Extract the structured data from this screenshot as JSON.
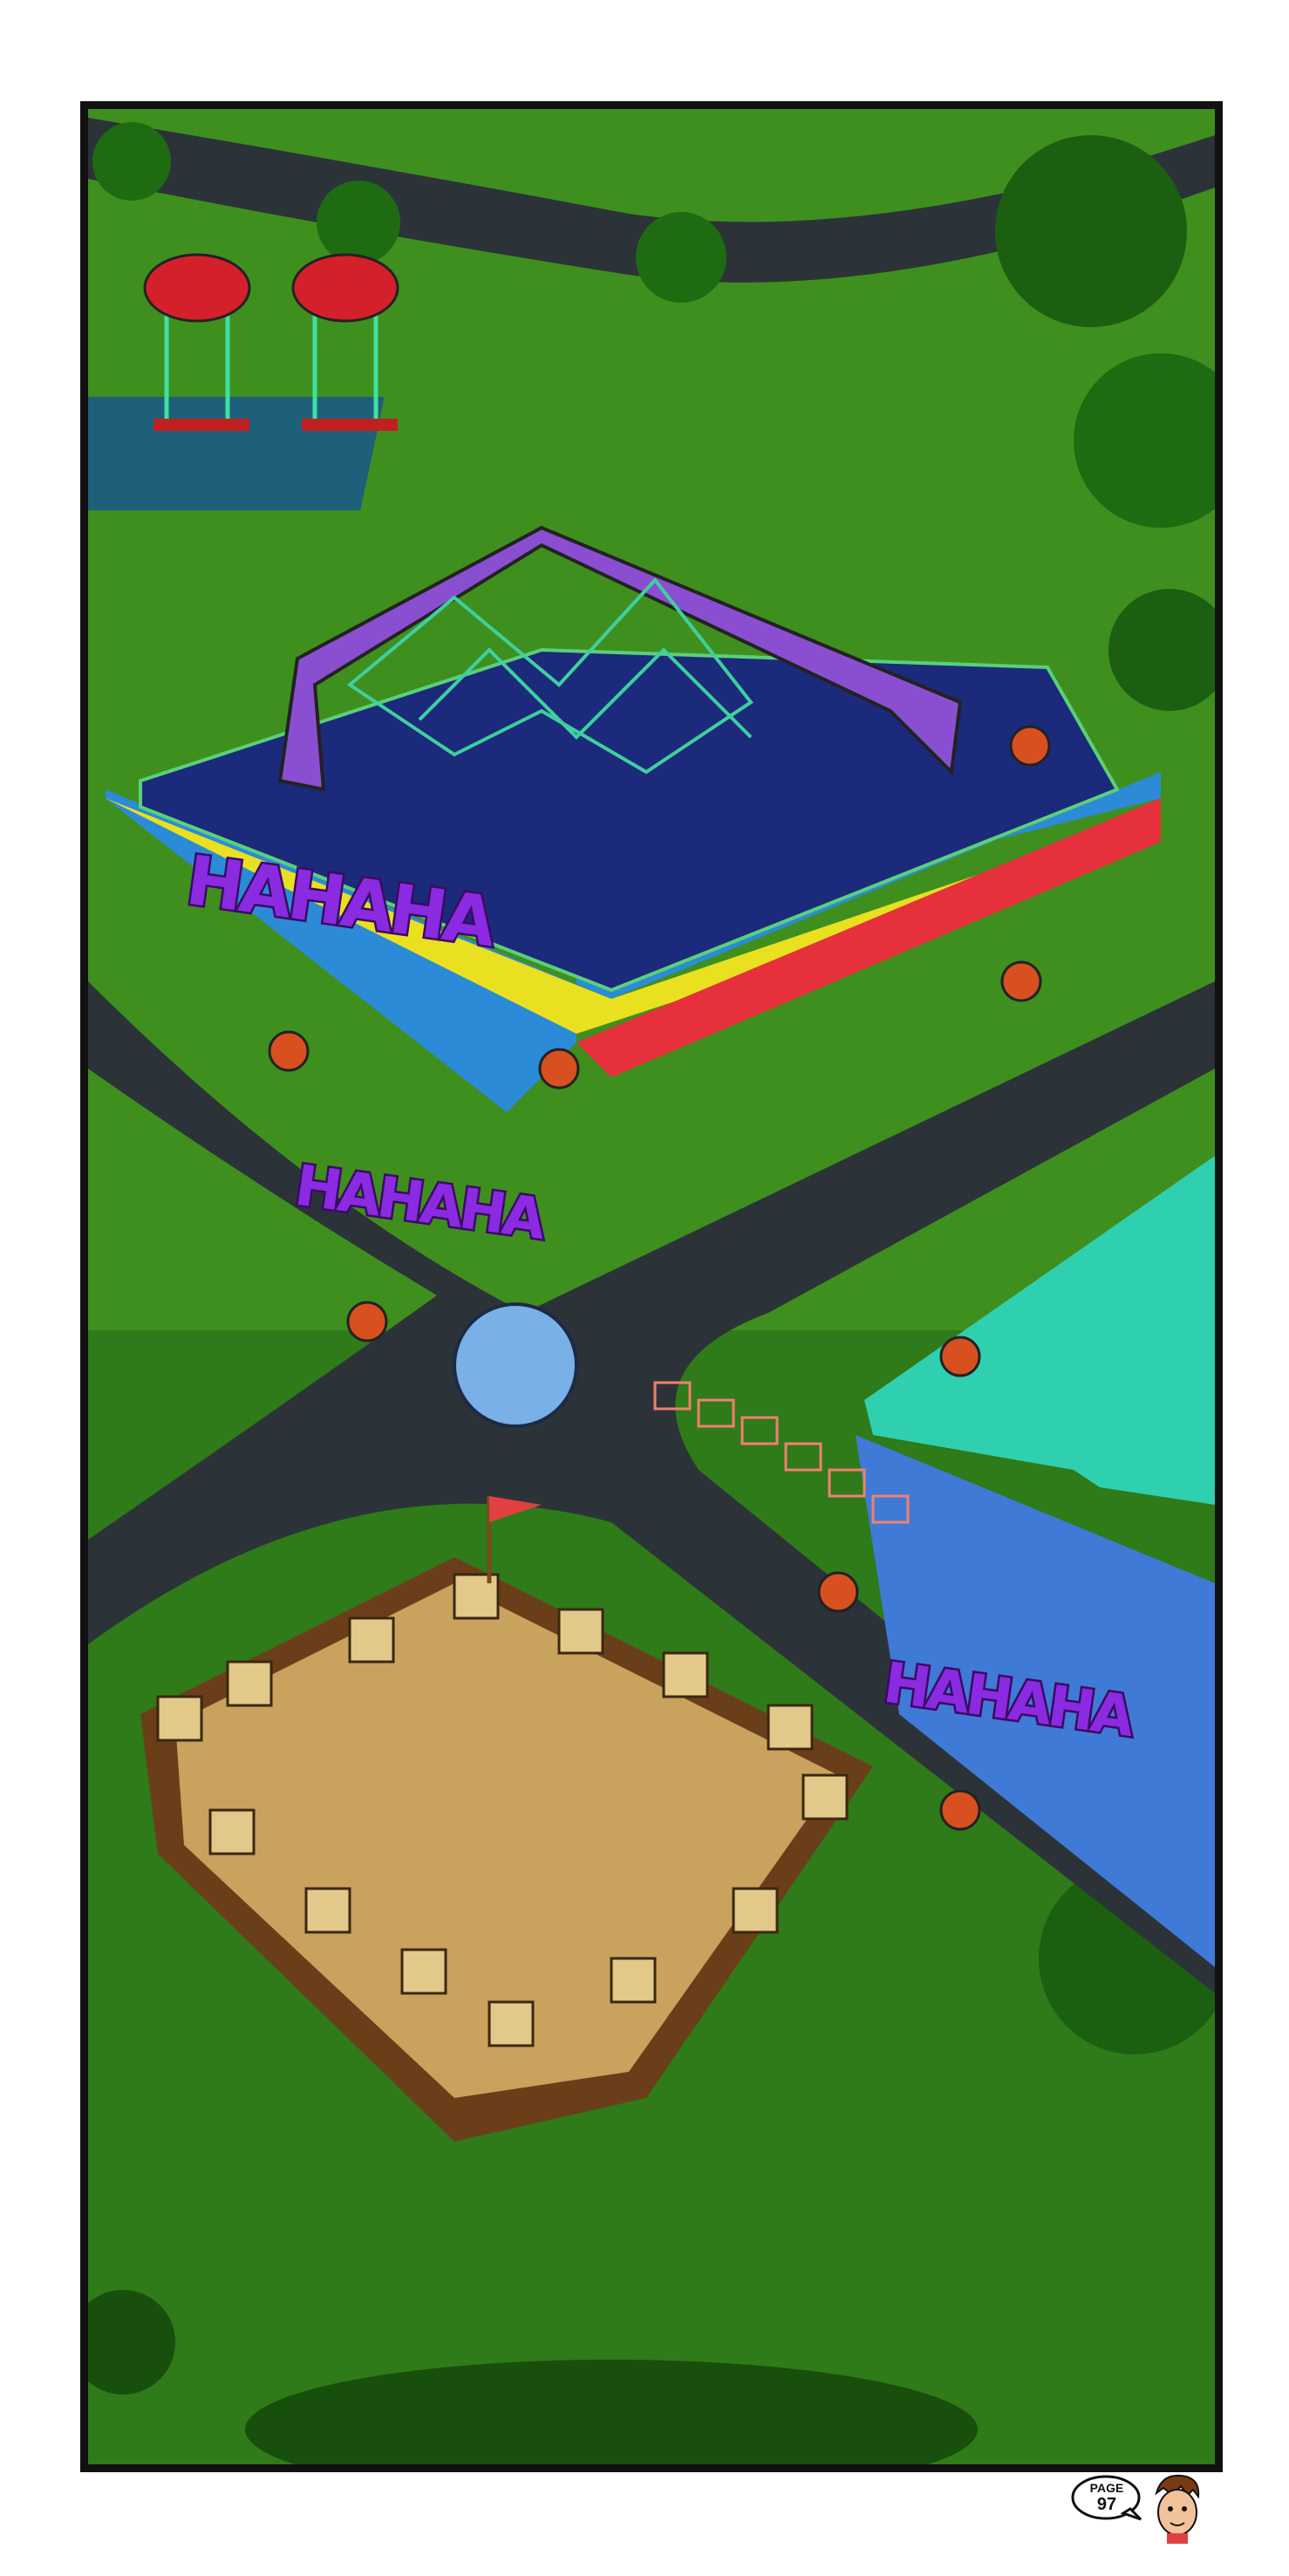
{
  "comic": {
    "sfx": [
      "HAHAHA",
      "HAHAHA",
      "HAHAHA"
    ],
    "page_word": "PAGE",
    "page_number": "97"
  },
  "colors": {
    "grass": "#3f8f1f",
    "path": "#2b3338",
    "sfx": "#8a2be2",
    "sand": "#c9a25e",
    "mat": "#1b2a7a"
  },
  "icons": [
    "ladybug-swing-icon",
    "climbing-frame-icon",
    "sandbox-castle-icon",
    "robot-icon",
    "tree-icon",
    "mascot-face-icon"
  ]
}
